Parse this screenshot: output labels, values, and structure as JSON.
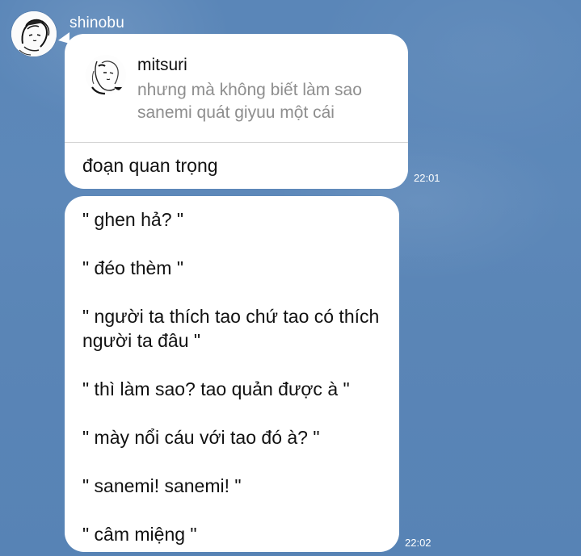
{
  "chat": {
    "sender_name": "shinobu",
    "messages": [
      {
        "reply": {
          "name": "mitsuri",
          "preview": "nhưng mà không biết làm sao sanemi quát giyuu một cái"
        },
        "text": "đoạn quan trọng",
        "time": "22:01"
      },
      {
        "lines": [
          "\" ghen hả? \"",
          "\" đéo thèm \"",
          "\" người ta thích tao chứ tao có thích người ta đâu \"",
          "\" thì làm sao? tao quản được à \"",
          "\" mày nổi cáu với tao đó à? \"",
          "\" sanemi! sanemi! \"",
          "\" câm miệng \""
        ],
        "time": "22:02"
      }
    ]
  },
  "colors": {
    "background": "#5b86b8",
    "bubble": "#ffffff",
    "text": "#111111",
    "reply_preview": "#8e8e8e",
    "timestamp": "#ffffff"
  },
  "icons": {
    "sender_avatar": "avatar-sketch-icon",
    "reply_avatar": "avatar-sketch-icon"
  }
}
